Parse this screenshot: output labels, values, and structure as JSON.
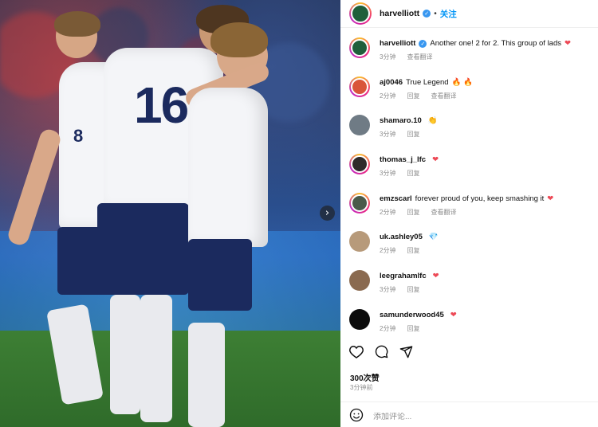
{
  "post": {
    "username": "harvelliott",
    "follow_label": "关注",
    "separator": "•",
    "carousel_next_glyph": "›"
  },
  "comments": [
    {
      "user": "harvelliott",
      "text": "Another one! 2 for 2. This group of lads",
      "emoji": "❤",
      "time": "3分钟",
      "reply": "",
      "translate": "查看翻译",
      "avatar_color": "#1f5f3b",
      "ring": true
    },
    {
      "user": "aj0046",
      "text": "True Legend",
      "emoji": "🔥 🔥",
      "time": "2分钟",
      "reply": "回复",
      "translate": "查看翻译",
      "avatar_color": "#d9553a",
      "ring": true
    },
    {
      "user": "shamaro.10",
      "text": "",
      "emoji": "👏",
      "time": "3分钟",
      "reply": "回复",
      "translate": "",
      "avatar_color": "#6f7b85",
      "ring": false
    },
    {
      "user": "thomas_j_lfc",
      "text": "",
      "emoji": "❤",
      "time": "3分钟",
      "reply": "回复",
      "translate": "",
      "avatar_color": "#2e2a2a",
      "ring": true
    },
    {
      "user": "emzscarl",
      "text": "forever proud of you, keep smashing it",
      "emoji": "❤",
      "time": "2分钟",
      "reply": "回复",
      "translate": "查看翻译",
      "avatar_color": "#4a5a4a",
      "ring": true
    },
    {
      "user": "uk.ashley05",
      "text": "",
      "emoji": "💎",
      "time": "2分钟",
      "reply": "回复",
      "translate": "",
      "avatar_color": "#b79a7a",
      "ring": false
    },
    {
      "user": "leegrahamlfc",
      "text": "",
      "emoji": "❤",
      "time": "3分钟",
      "reply": "回复",
      "translate": "",
      "avatar_color": "#8a6a50",
      "ring": false
    },
    {
      "user": "samunderwood45",
      "text": "",
      "emoji": "❤",
      "time": "2分钟",
      "reply": "回复",
      "translate": "",
      "avatar_color": "#0c0c0c",
      "ring": false
    }
  ],
  "stats": {
    "likes": "300次赞",
    "time": "3分钟前"
  },
  "add_comment": {
    "placeholder": "添加评论..."
  },
  "icons": {
    "like": "heart-outline-icon",
    "comment": "comment-bubble-icon",
    "share": "paper-plane-icon",
    "emoji": "smiley-icon",
    "verified": "verified-badge-icon",
    "next": "chevron-right-icon"
  },
  "photo": {
    "shirt_number": "16",
    "shirt_number_side": "8"
  },
  "colors": {
    "accent": "#0095f6",
    "heart": "#ed4956",
    "meta": "#8e8e8e"
  }
}
